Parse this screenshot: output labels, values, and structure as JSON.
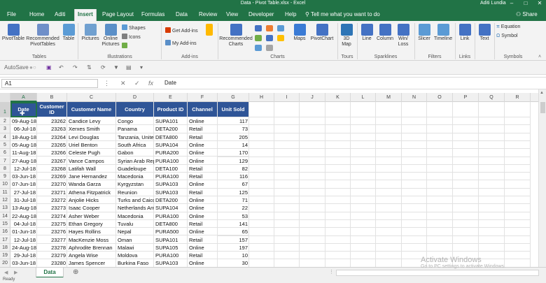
{
  "window": {
    "title": "Data - Pivot Table.xlsx  -  Excel",
    "user": "Aditi Lundia"
  },
  "tabs": [
    "File",
    "Home",
    "Aditi",
    "Insert",
    "Page Layout",
    "Formulas",
    "Data",
    "Review",
    "View",
    "Developer",
    "Help"
  ],
  "active_tab": "Insert",
  "tell_me": "Tell me what you want to do",
  "share_label": "Share",
  "ribbon": {
    "tables": {
      "label": "Tables",
      "pivottable": "PivotTable",
      "recommended": "Recommended PivotTables",
      "table": "Table"
    },
    "illustrations": {
      "label": "Illustrations",
      "pictures": "Pictures",
      "online_pictures": "Online Pictures",
      "shapes": "Shapes",
      "icons": "Icons"
    },
    "addins": {
      "label": "Add-ins",
      "get": "Get Add-ins",
      "my": "My Add-ins"
    },
    "charts": {
      "label": "Charts",
      "recommended": "Recommended Charts",
      "maps": "Maps",
      "pivotchart": "PivotChart"
    },
    "tours": {
      "label": "Tours",
      "map3d": "3D Map"
    },
    "sparklines": {
      "label": "Sparklines",
      "line": "Line",
      "column": "Column",
      "winloss": "Win/ Loss"
    },
    "filters": {
      "label": "Filters",
      "slicer": "Slicer",
      "timeline": "Timeline"
    },
    "links": {
      "label": "Links",
      "link": "Link"
    },
    "text": {
      "label": "",
      "text": "Text"
    },
    "symbols": {
      "label": "Symbols",
      "equation": "Equation",
      "symbol": "Symbol"
    }
  },
  "qat": {
    "autosave": "AutoSave"
  },
  "name_box": "A1",
  "formula": "Date",
  "columns": [
    "A",
    "B",
    "C",
    "D",
    "E",
    "F",
    "G",
    "H",
    "I",
    "J",
    "K",
    "L",
    "M",
    "N",
    "O",
    "P",
    "Q",
    "R"
  ],
  "headers": [
    "Date",
    "Customer ID",
    "Customer Name",
    "Country",
    "Product ID",
    "Channel",
    "Unit Sold"
  ],
  "rows": [
    [
      "09-Aug-18",
      "23262",
      "Candice Levy",
      "Congo",
      "SUPA101",
      "Online",
      "117"
    ],
    [
      "06-Jul-18",
      "23263",
      "Xerxes Smith",
      "Panama",
      "DETA200",
      "Retail",
      "73"
    ],
    [
      "18-Aug-18",
      "23264",
      "Levi Douglas",
      "Tanzania, United",
      "DETA800",
      "Retail",
      "205"
    ],
    [
      "05-Aug-18",
      "23265",
      "Uriel Benton",
      "South Africa",
      "SUPA104",
      "Online",
      "14"
    ],
    [
      "11-Aug-18",
      "23266",
      "Celeste Pugh",
      "Gabon",
      "PURA200",
      "Online",
      "170"
    ],
    [
      "27-Aug-18",
      "23267",
      "Vance Campos",
      "Syrian Arab Rep",
      "PURA100",
      "Online",
      "129"
    ],
    [
      "12-Jul-18",
      "23268",
      "Latifah Wall",
      "Guadeloupe",
      "DETA100",
      "Retail",
      "82"
    ],
    [
      "03-Jun-18",
      "23269",
      "Jane Hernandez",
      "Macedonia",
      "PURA100",
      "Retail",
      "116"
    ],
    [
      "07-Jun-18",
      "23270",
      "Wanda Garza",
      "Kyrgyzstan",
      "SUPA103",
      "Online",
      "67"
    ],
    [
      "27-Jul-18",
      "23271",
      "Athena Fitzpatrick",
      "Reunion",
      "SUPA103",
      "Retail",
      "125"
    ],
    [
      "31-Jul-18",
      "23272",
      "Anjolie Hicks",
      "Turks and Caicos",
      "DETA200",
      "Online",
      "71"
    ],
    [
      "13-Aug-18",
      "23273",
      "Isaac Cooper",
      "Netherlands Ant",
      "SUPA104",
      "Online",
      "22"
    ],
    [
      "22-Aug-18",
      "23274",
      "Asher Weber",
      "Macedonia",
      "PURA100",
      "Online",
      "53"
    ],
    [
      "04-Jul-18",
      "23275",
      "Ethan Gregory",
      "Tuvalu",
      "DETA800",
      "Retail",
      "141"
    ],
    [
      "01-Jun-18",
      "23276",
      "Hayes Rollins",
      "Nepal",
      "PURA500",
      "Online",
      "65"
    ],
    [
      "12-Jul-18",
      "23277",
      "MacKenzie Moss",
      "Oman",
      "SUPA101",
      "Retail",
      "157"
    ],
    [
      "24-Aug-18",
      "23278",
      "Aphrodite Brennan",
      "Malawi",
      "SUPA105",
      "Online",
      "197"
    ],
    [
      "29-Jul-18",
      "23279",
      "Angela Wise",
      "Moldova",
      "PURA100",
      "Retail",
      "10"
    ],
    [
      "03-Jun-18",
      "23280",
      "James Spencer",
      "Burkina Faso",
      "SUPA103",
      "Online",
      "30"
    ]
  ],
  "row_numbers": [
    "1",
    "2",
    "3",
    "4",
    "5",
    "6",
    "7",
    "8",
    "9",
    "10",
    "11",
    "12",
    "13",
    "14",
    "15",
    "16",
    "17",
    "18",
    "19",
    "20"
  ],
  "sheet_tab": "Data",
  "status": "Ready",
  "watermark": {
    "line1": "Activate Windows",
    "line2": "Go to PC settings to activate Windows."
  },
  "colors": {
    "excel_green": "#217346",
    "header_fill": "#2f5597"
  }
}
